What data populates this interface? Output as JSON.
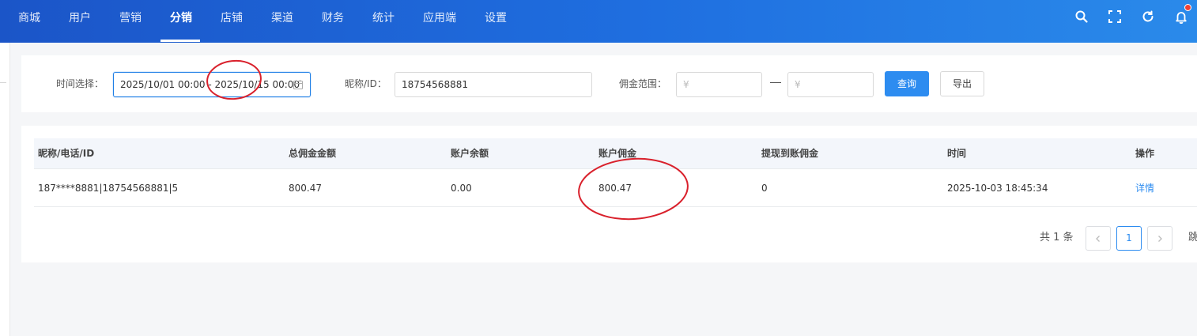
{
  "nav": {
    "items": [
      {
        "label": "商城"
      },
      {
        "label": "用户"
      },
      {
        "label": "营销"
      },
      {
        "label": "分销"
      },
      {
        "label": "店铺"
      },
      {
        "label": "渠道"
      },
      {
        "label": "财务"
      },
      {
        "label": "统计"
      },
      {
        "label": "应用端"
      },
      {
        "label": "设置"
      }
    ],
    "active_label": "分销",
    "icons": [
      "search-icon",
      "fullscreen-icon",
      "refresh-icon",
      "bell-icon"
    ],
    "accent_color": "#1f6fe0"
  },
  "filter": {
    "time_label": "时间选择：",
    "time_value": "2025/10/01 00:00 - 2025/10/15 00:00",
    "nickname_label": "昵称/ID：",
    "nickname_value": "18754568881",
    "commission_label": "佣金范围：",
    "min_placeholder": "¥",
    "max_placeholder": "¥",
    "range_separator": "—",
    "query_button": "查询",
    "export_button": "导出"
  },
  "table": {
    "columns": [
      "昵称/电话/ID",
      "总佣金金额",
      "账户余额",
      "账户佣金",
      "提现到账佣金",
      "时间",
      "操作"
    ],
    "rows": [
      {
        "user": "187****8881|18754568881|5",
        "total_commission": "800.47",
        "account_balance": "0.00",
        "account_commission": "800.47",
        "withdrawn_commission": "0",
        "time": "2025-10-03 18:45:34",
        "action": "详情"
      }
    ]
  },
  "pagination": {
    "total_text": "共 1 条",
    "current_page": "1",
    "jump_text": "跳"
  },
  "annotation_color": "#d9212c"
}
